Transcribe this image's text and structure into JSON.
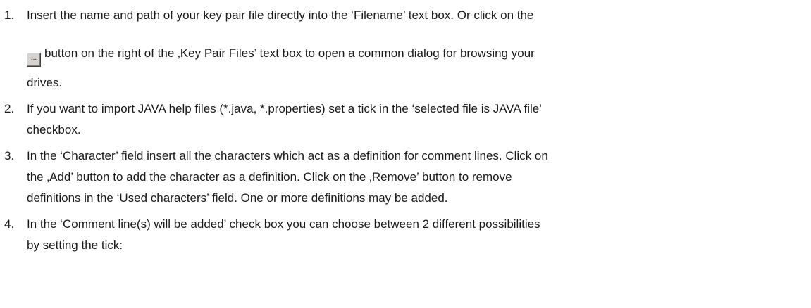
{
  "items": [
    {
      "number": "1.",
      "line1": "Insert the name and path of your key pair file directly into the ‘Filename’ text box. Or click on the",
      "browse_button_label": "...",
      "line2": "button on the right of the ‚Key Pair Files’ text box to open a common dialog for browsing your",
      "line3": "drives."
    },
    {
      "number": "2.",
      "line1": "If you want to import JAVA help files (*.java, *.properties) set a tick in the ‘selected file is JAVA file’",
      "line2": "checkbox."
    },
    {
      "number": "3.",
      "line1": "In the ‘Character’ field insert all the characters which act as a definition for comment lines. Click on",
      "line2": "the ‚Add’ button to add the character as a definition. Click on the ‚Remove’ button to remove",
      "line3": "definitions in the ‘Used characters’ field. One or more definitions may be added."
    },
    {
      "number": "4.",
      "line1": "In the ‘Comment line(s) will be added’ check box you can choose between 2 different possibilities",
      "line2": "by setting the tick:"
    }
  ]
}
